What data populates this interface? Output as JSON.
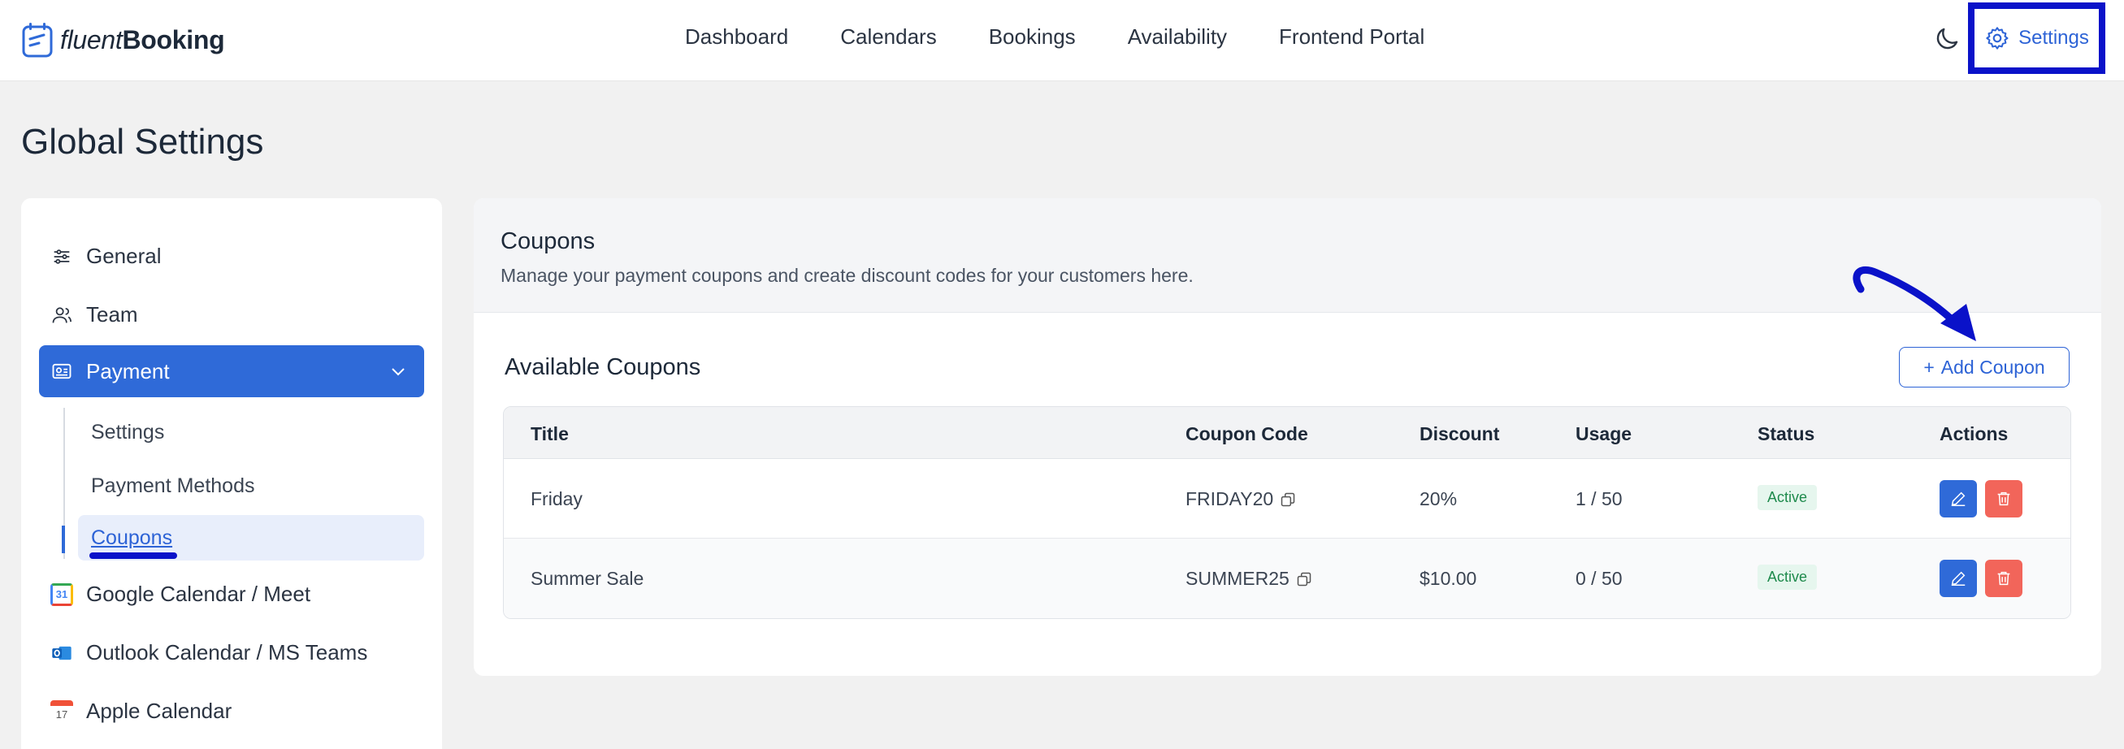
{
  "brand": {
    "name_part1": "fluent",
    "name_part2": "Booking"
  },
  "nav": {
    "items": [
      "Dashboard",
      "Calendars",
      "Bookings",
      "Availability",
      "Frontend Portal"
    ],
    "settings_label": "Settings"
  },
  "page": {
    "title": "Global Settings"
  },
  "sidebar": {
    "general": "General",
    "team": "Team",
    "payment": "Payment",
    "payment_sub": [
      "Settings",
      "Payment Methods",
      "Coupons"
    ],
    "google": "Google Calendar / Meet",
    "google_icon_text": "31",
    "outlook": "Outlook Calendar / MS Teams",
    "apple": "Apple Calendar",
    "apple_icon_text": "17"
  },
  "main": {
    "title": "Coupons",
    "description": "Manage your payment coupons and create discount codes for your customers here.",
    "available_title": "Available Coupons",
    "add_button": "Add Coupon"
  },
  "table": {
    "headers": [
      "Title",
      "Coupon Code",
      "Discount",
      "Usage",
      "Status",
      "Actions"
    ],
    "rows": [
      {
        "title": "Friday",
        "code": "FRIDAY20",
        "discount": "20%",
        "usage": "1 / 50",
        "status": "Active"
      },
      {
        "title": "Summer Sale",
        "code": "SUMMER25",
        "discount": "$10.00",
        "usage": "0 / 50",
        "status": "Active"
      }
    ]
  },
  "colors": {
    "accent": "#2f6ad8",
    "highlight": "#0a12c9",
    "danger": "#f2655a",
    "success": "#1e8a4c"
  }
}
